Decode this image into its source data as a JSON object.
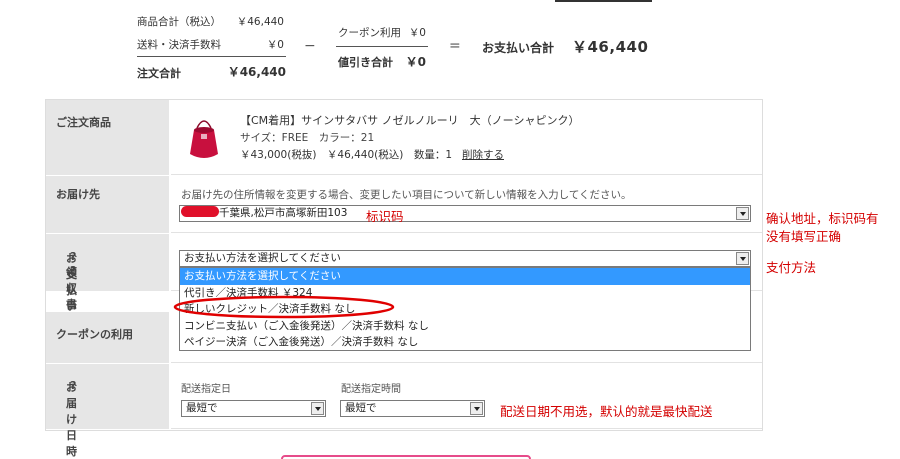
{
  "summary": {
    "subtotal_label": "商品合計（税込）",
    "subtotal_value": "￥46,440",
    "shipping_label": "送料・決済手数料",
    "shipping_value": "￥0",
    "order_total_label": "注文合計",
    "order_total_value": "￥46,440",
    "minus": "−",
    "coupon_label": "クーポン利用",
    "coupon_value": "￥0",
    "discount_label": "値引き合計",
    "discount_value": "￥0",
    "equals": "=",
    "grand_label": "お支払い合計",
    "grand_value": "￥46,440"
  },
  "rows": {
    "product_label": "ご注文商品",
    "address_label": "お届け先",
    "payment_label": "お支払い方法",
    "receipt_label": "領収書について",
    "help_q": "?",
    "coupon_row_label": "クーポンの利用",
    "delivery_label": "お届け日時"
  },
  "product": {
    "name": "【CM着用】サインサタバサ ノゼルノルーリ　大（ノーシャピンク）",
    "spec": "サイズ：FREE　カラー：21",
    "price": "￥43,000(税抜)　￥46,440(税込)　数量：1",
    "delete_link": "削除する"
  },
  "address": {
    "note": "お届け先の住所情報を変更する場合、変更したい項目について新しい情報を入力してください。",
    "selected": "千葉県,松戸市高塚新田103"
  },
  "payment": {
    "selected": "お支払い方法を選択してください",
    "options": [
      "お支払い方法を選択してください",
      "代引き／決済手数料 ￥324",
      "新しいクレジット／決済手数料 なし",
      "コンビニ支払い（ご入金後発送）／決済手数料 なし",
      "ペイジー決済（ご入金後発送）／決済手数料 なし"
    ]
  },
  "delivery": {
    "date_label": "配送指定日",
    "date_value": "最短で",
    "time_label": "配送指定時間",
    "time_value": "最短で"
  },
  "annotations": {
    "id_code": "标识码",
    "confirm_address_1": "确认地址，标识码有",
    "confirm_address_2": "没有填写正确",
    "payment_method": "支付方法",
    "delivery_note": "配送日期不用选，默认的就是最快配送"
  },
  "colors": {
    "highlight": "#3399ff",
    "annotation": "#d40000",
    "label_bg": "#e6e6e6",
    "redact": "#e0102a",
    "product_pink": "#c8103e"
  }
}
